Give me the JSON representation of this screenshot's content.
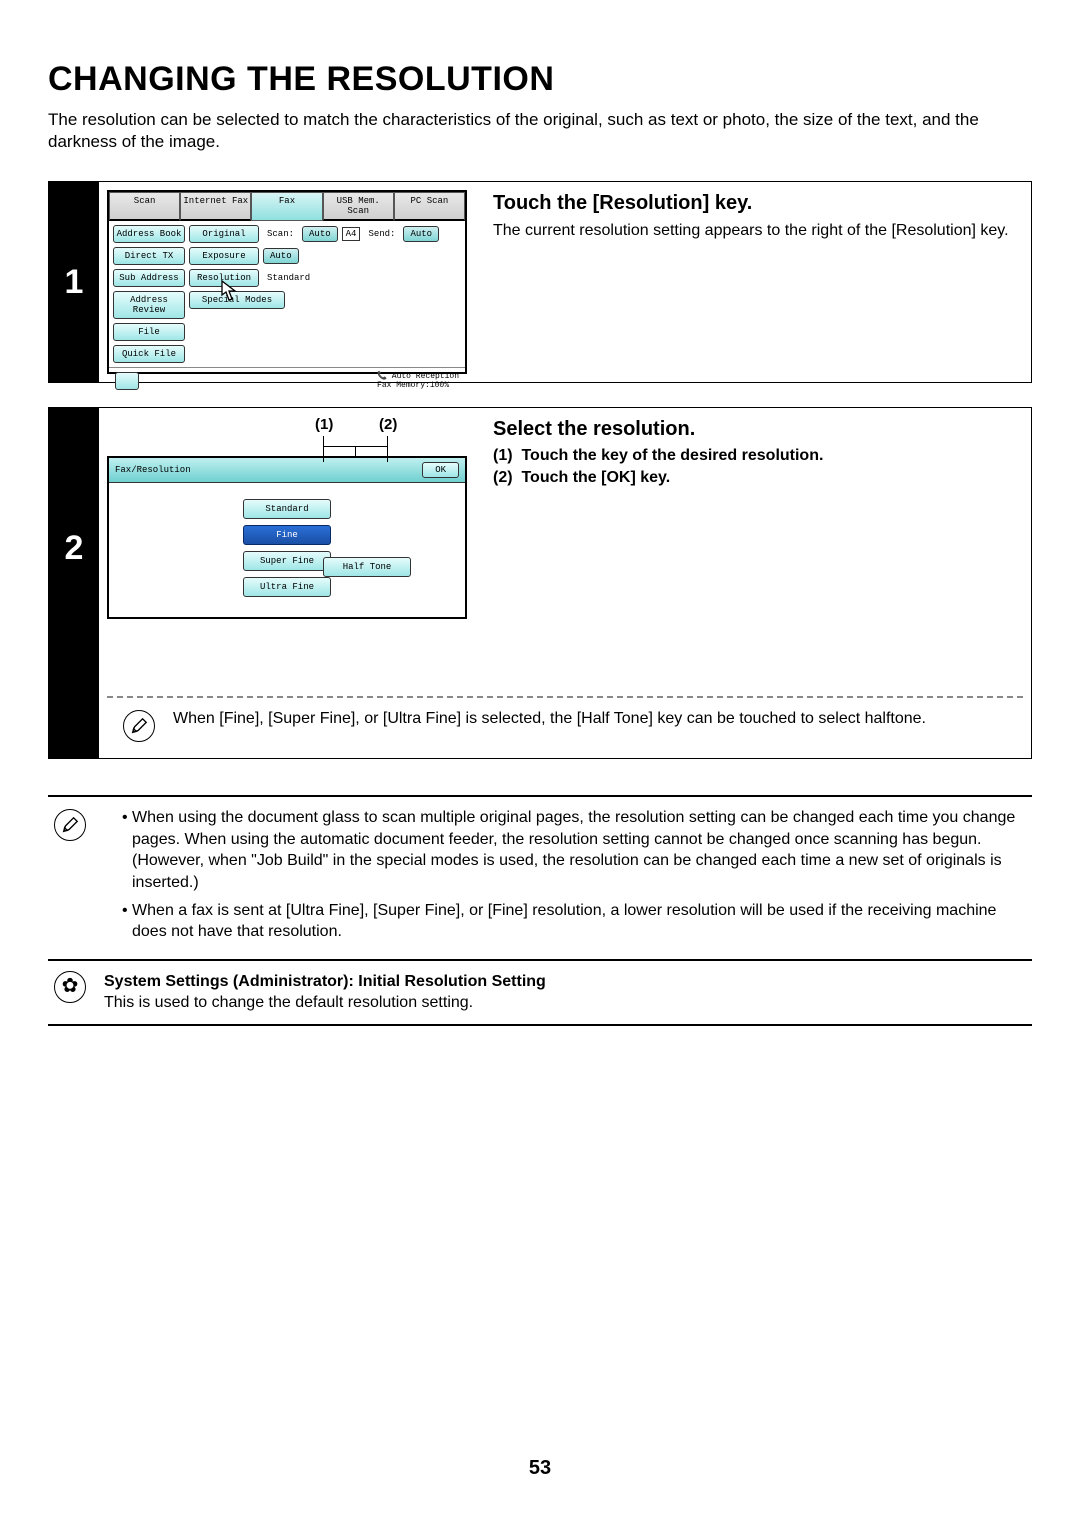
{
  "title": "CHANGING THE RESOLUTION",
  "intro": "The resolution can be selected to match the characteristics of the original, such as text or photo, the size of the text, and the darkness of the image.",
  "step1": {
    "num": "1",
    "heading": "Touch the [Resolution] key.",
    "desc": "The current resolution setting appears to the right of the [Resolution] key.",
    "tabs": [
      "Scan",
      "Internet Fax",
      "Fax",
      "USB Mem. Scan",
      "PC Scan"
    ],
    "active_tab": "Fax",
    "side_buttons": [
      "Address Book",
      "Direct TX",
      "Sub Address",
      "Address Review",
      "File",
      "Quick File"
    ],
    "rows": {
      "original": {
        "label": "Original",
        "scan": "Scan:",
        "auto": "Auto",
        "size": "A4",
        "send": "Send:",
        "send_auto": "Auto"
      },
      "exposure": {
        "label": "Exposure",
        "value": "Auto"
      },
      "resolution": {
        "label": "Resolution",
        "value": "Standard"
      },
      "special": {
        "label": "Special Modes"
      }
    },
    "footer": {
      "auto": "Auto Reception",
      "mem": "Fax Memory:100%"
    }
  },
  "step2": {
    "num": "2",
    "heading": "Select the resolution.",
    "sub1_num": "(1)",
    "sub1": "Touch the key of the desired resolution.",
    "sub2_num": "(2)",
    "sub2": "Touch the [OK] key.",
    "callout1": "(1)",
    "callout2": "(2)",
    "panel_title": "Fax/Resolution",
    "ok": "OK",
    "options": [
      "Standard",
      "Fine",
      "Super Fine",
      "Ultra Fine"
    ],
    "selected": "Fine",
    "halftone": "Half Tone",
    "note": "When [Fine], [Super Fine], or [Ultra Fine] is selected, the [Half Tone] key can be touched to select halftone."
  },
  "bottom_notes": [
    "When using the document glass to scan multiple original pages, the resolution setting can be changed each time you change pages. When using the automatic document feeder, the resolution setting cannot be changed once scanning has begun. (However, when \"Job Build\" in the special modes is used, the resolution can be changed each time a new set of originals is inserted.)",
    "When a fax is sent at [Ultra Fine], [Super Fine], or [Fine] resolution, a lower resolution will be used if the receiving machine does not have that resolution."
  ],
  "sys_title": "System Settings (Administrator): Initial Resolution Setting",
  "sys_desc": "This is used to change the default resolution setting.",
  "page_number": "53"
}
